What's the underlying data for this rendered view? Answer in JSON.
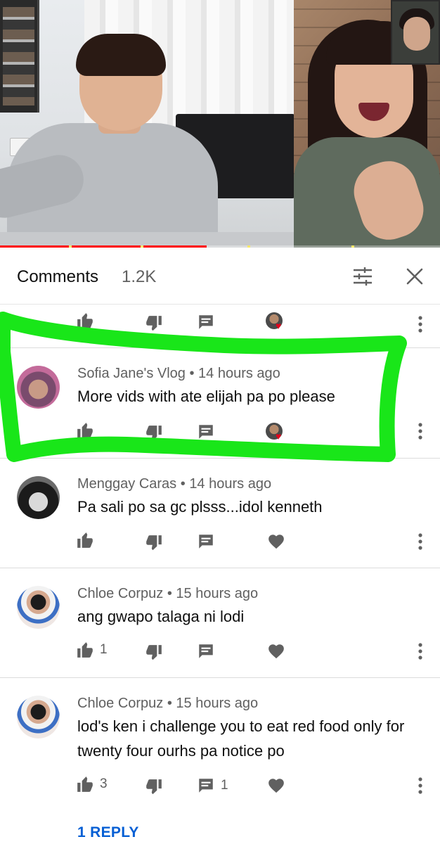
{
  "comments_panel": {
    "title": "Comments",
    "count": "1.2K",
    "filter_icon": "sort-filter-icon",
    "close_icon": "close-icon"
  },
  "colors": {
    "progress_red": "#ff0000",
    "link_blue": "#065fd4",
    "annotation_green": "#19e619",
    "heart_red": "#e3001b",
    "meta_gray": "#606060"
  },
  "video": {
    "progress_fraction": 0.47
  },
  "comments": [
    {
      "author": "Sofia Jane's Vlog",
      "time": "14 hours ago",
      "text": "More vids with ate elijah pa po please",
      "likes": "",
      "replies": "",
      "creator_hearted": true,
      "highlighted": true
    },
    {
      "author": "Menggay Caras",
      "time": "14 hours ago",
      "text": "Pa sali po sa gc plsss...idol kenneth",
      "likes": "",
      "replies": "",
      "creator_hearted": false
    },
    {
      "author": "Chloe Corpuz",
      "time": "15 hours ago",
      "text": "ang gwapo talaga ni lodi",
      "likes": "1",
      "replies": "",
      "creator_hearted": false
    },
    {
      "author": "Chloe Corpuz",
      "time": "15 hours ago",
      "text": "lod's ken i challenge you to eat red food only for twenty four ourhs pa notice po",
      "likes": "3",
      "replies": "1",
      "creator_hearted": false,
      "reply_link": "1 REPLY"
    }
  ]
}
